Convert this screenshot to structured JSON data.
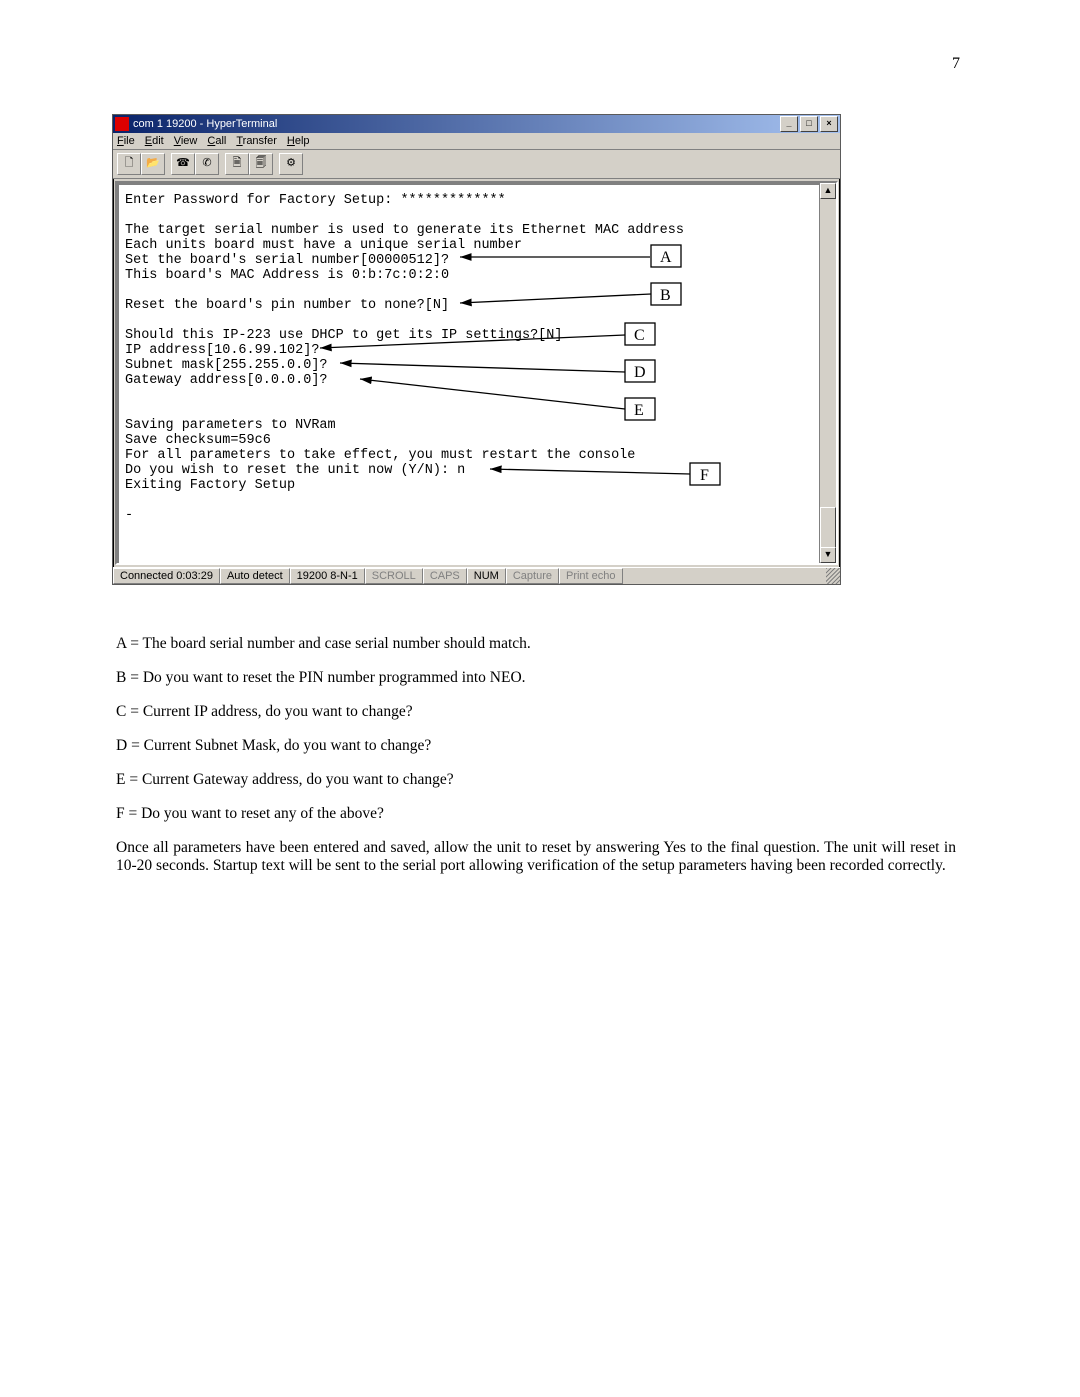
{
  "page_number": "7",
  "window": {
    "title": "com 1 19200 - HyperTerminal",
    "menu": {
      "file": "File",
      "edit": "Edit",
      "view": "View",
      "call": "Call",
      "transfer": "Transfer",
      "help": "Help"
    },
    "btn": {
      "min": "_",
      "max": "□",
      "close": "×"
    },
    "scroll": {
      "up": "▲",
      "down": "▼"
    }
  },
  "terminal": {
    "lines": [
      "Enter Password for Factory Setup: *************",
      "",
      "The target serial number is used to generate its Ethernet MAC address",
      "Each units board must have a unique serial number",
      "Set the board's serial number[00000512]?",
      "This board's MAC Address is 0:b:7c:0:2:0",
      "",
      "Reset the board's pin number to none?[N]",
      "",
      "Should this IP-223 use DHCP to get its IP settings?[N]",
      "IP address[10.6.99.102]?",
      "Subnet mask[255.255.0.0]?",
      "Gateway address[0.0.0.0]?",
      "",
      "",
      "Saving parameters to NVRam",
      "Save checksum=59c6",
      "For all parameters to take effect, you must restart the console",
      "Do you wish to reset the unit now (Y/N): n",
      "Exiting Factory Setup",
      "",
      "-"
    ]
  },
  "status": {
    "connected": "Connected 0:03:29",
    "detect": "Auto detect",
    "mode": "19200 8-N-1",
    "scroll": "SCROLL",
    "caps": "CAPS",
    "num": "NUM",
    "capture": "Capture",
    "print": "Print echo"
  },
  "callouts": {
    "A": "A",
    "B": "B",
    "C": "C",
    "D": "D",
    "E": "E",
    "F": "F"
  },
  "legend": {
    "A": "A = The board serial number and case serial number should match.",
    "B": "B = Do you want to reset the PIN number programmed into NEO.",
    "C": "C = Current IP address, do you want to change?",
    "D": "D = Current Subnet Mask, do you want to change?",
    "E": "E = Current Gateway address, do you want to change?",
    "F": "F = Do you want to reset any of the above?",
    "para": "Once all parameters have been entered and saved, allow the unit to reset by answering Yes to the final question.  The unit will reset in 10-20 seconds.  Startup text will be sent to the serial port allowing verification of the setup parameters having been recorded correctly."
  }
}
